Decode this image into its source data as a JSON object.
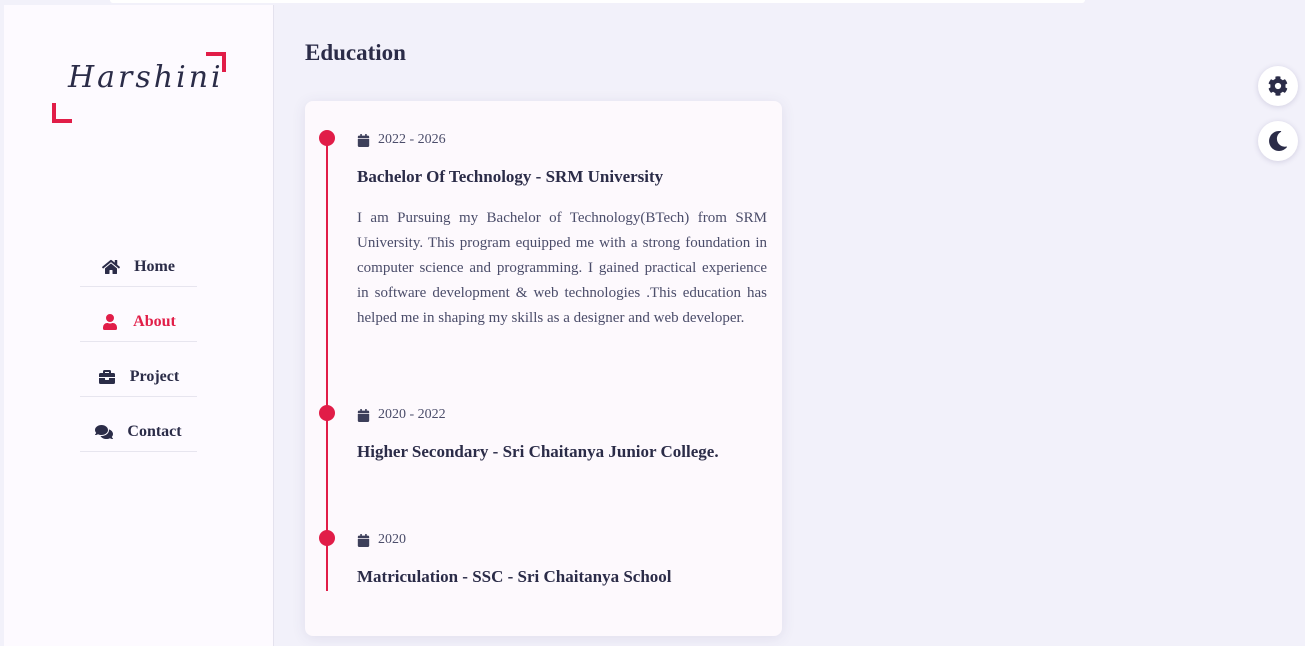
{
  "brand": {
    "logo_text": "Harshini",
    "accent_color": "#e11d48"
  },
  "nav": {
    "items": [
      {
        "label": "Home",
        "icon": "home-icon",
        "active": false
      },
      {
        "label": "About",
        "icon": "user-icon",
        "active": true
      },
      {
        "label": "Project",
        "icon": "briefcase-icon",
        "active": false
      },
      {
        "label": "Contact",
        "icon": "comments-icon",
        "active": false
      }
    ]
  },
  "section": {
    "title": "Education"
  },
  "education": [
    {
      "date": "2022 - 2026",
      "title": "Bachelor Of Technology - SRM University",
      "description": "I am Pursuing my Bachelor of Technology(BTech) from SRM University. This program equipped me with a strong foundation in computer science and programming. I gained practical experience in software development & web technologies .This education has helped me in shaping my skills as a designer and web developer."
    },
    {
      "date": "2020 - 2022",
      "title": "Higher Secondary - Sri Chaitanya Junior College.",
      "description": ""
    },
    {
      "date": "2020",
      "title": "Matriculation - SSC - Sri Chaitanya School",
      "description": ""
    }
  ],
  "controls": {
    "settings_icon": "gear-icon",
    "theme_icon": "moon-icon"
  }
}
